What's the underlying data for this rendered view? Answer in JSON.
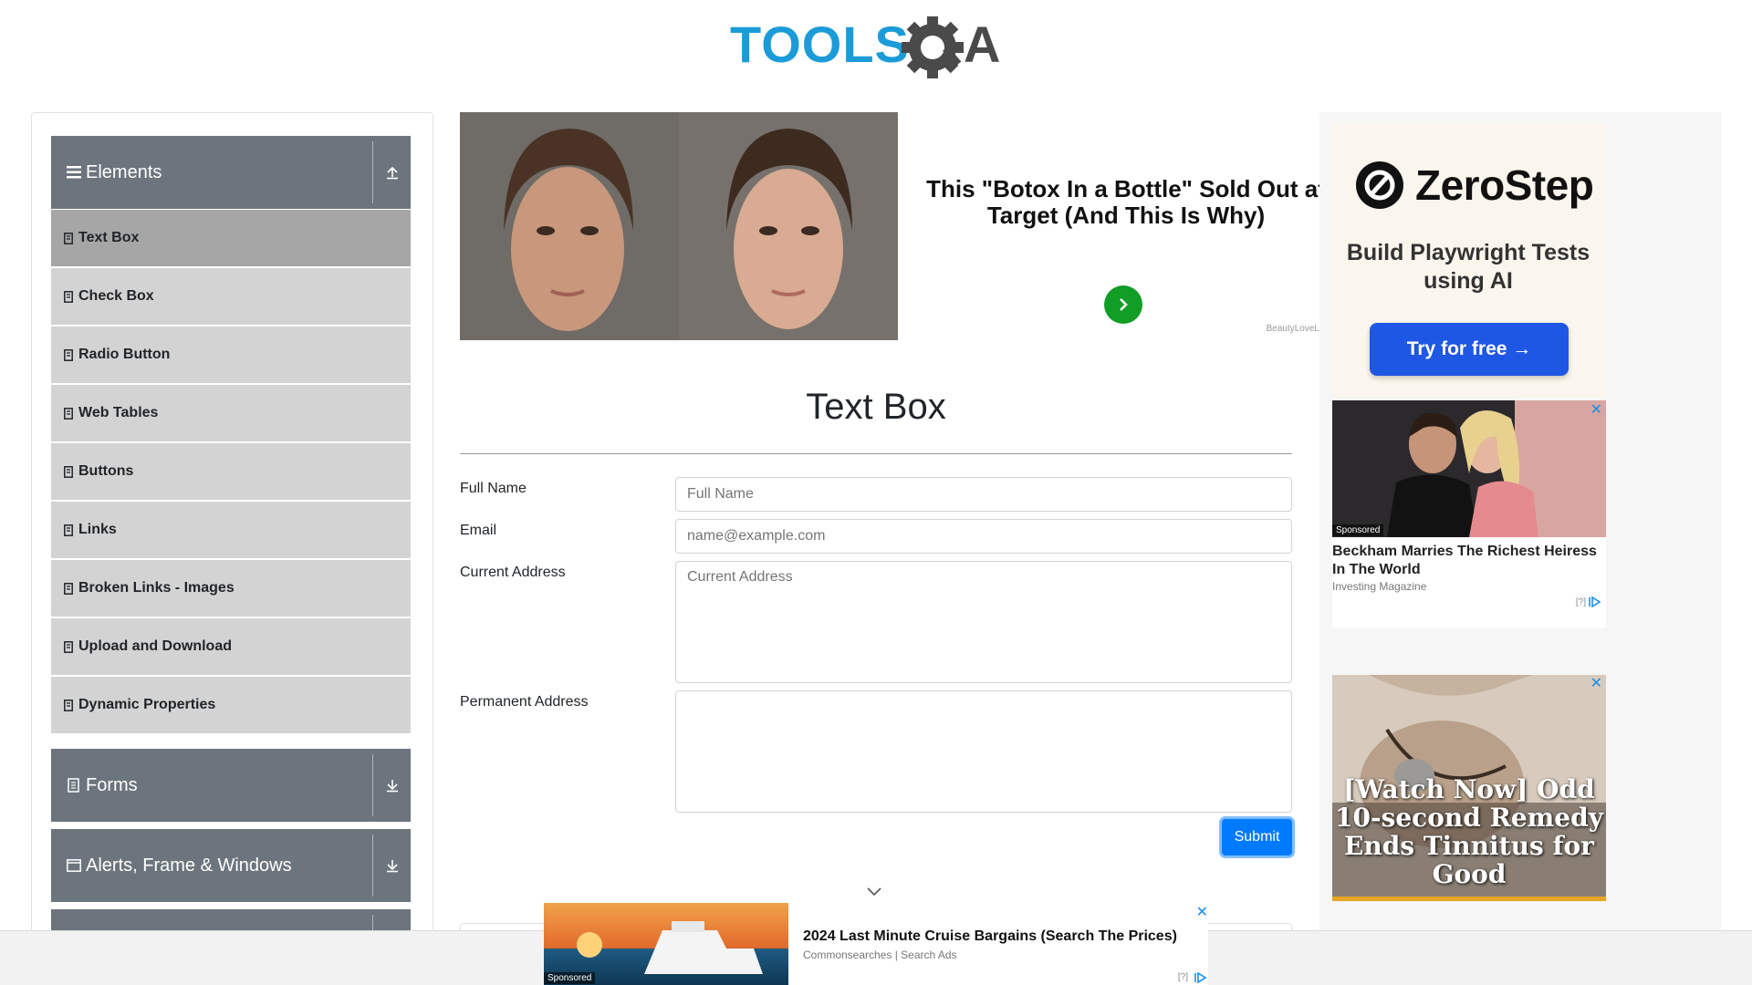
{
  "header": {
    "logo_text": "TOOLSQA"
  },
  "sidebar": {
    "groups": [
      {
        "title": "Elements",
        "icon": "menu-lines-icon",
        "toggle_icon": "collapse-up-icon"
      },
      {
        "title": "Forms",
        "icon": "document-icon",
        "toggle_icon": "expand-down-icon"
      },
      {
        "title": "Alerts, Frame & Windows",
        "icon": "window-icon",
        "toggle_icon": "expand-down-icon"
      }
    ],
    "items": [
      {
        "label": "Text Box",
        "active": true
      },
      {
        "label": "Check Box"
      },
      {
        "label": "Radio Button"
      },
      {
        "label": "Web Tables"
      },
      {
        "label": "Buttons"
      },
      {
        "label": "Links"
      },
      {
        "label": "Broken Links - Images"
      },
      {
        "label": "Upload and Download"
      },
      {
        "label": "Dynamic Properties"
      }
    ]
  },
  "top_ad": {
    "headline": "This \"Botox In a Bottle\" Sold Out at Target (And This Is Why)",
    "brand": "BeautyLoveL"
  },
  "right_ads": {
    "zerostep": {
      "name": "ZeroStep",
      "tagline": "Build Playwright Tests using AI",
      "cta": "Try for free →"
    },
    "card": {
      "sponsored": "Sponsored",
      "title": "Beckham Marries The Richest Heiress In The World",
      "source": "Investing Magazine",
      "adchoice": "[?]"
    },
    "tinnitus": {
      "text": "[Watch Now] Odd 10-second Remedy Ends Tinnitus for Good"
    }
  },
  "form": {
    "title": "Text Box",
    "full_name_label": "Full Name",
    "full_name_placeholder": "Full Name",
    "email_label": "Email",
    "email_placeholder": "name@example.com",
    "current_address_label": "Current Address",
    "current_address_placeholder": "Current Address",
    "permanent_address_label": "Permanent Address",
    "permanent_address_placeholder": "",
    "submit_label": "Submit"
  },
  "bottom_ad": {
    "title": "2024 Last Minute Cruise Bargains (Search The Prices)",
    "source": "Commonsearches | Search Ads",
    "sponsored": "Sponsored",
    "adchoice": "[?]"
  },
  "colors": {
    "accent": "#007bff",
    "sidebar_header": "#6c757d",
    "sidebar_item": "#d3d3d3",
    "sidebar_active": "#a6a6a6",
    "logo_blue": "#1b9bd8"
  }
}
